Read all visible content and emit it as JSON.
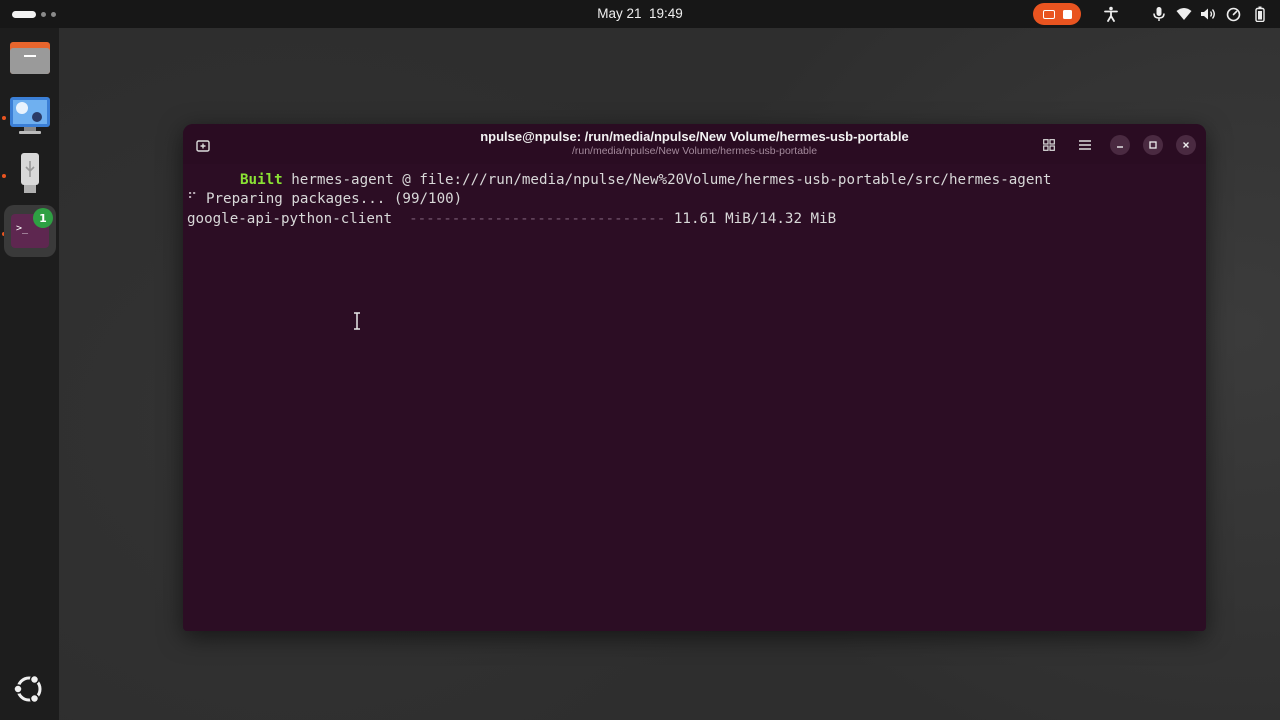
{
  "topbar": {
    "date": "May 21",
    "time": "19:49",
    "colors": {
      "recording_accent": "#e95420"
    },
    "tray_icons": [
      "accessibility-icon",
      "microphone-icon",
      "wifi-icon",
      "volume-icon",
      "power-profile-icon",
      "battery-icon"
    ]
  },
  "dock": {
    "items": [
      "files-icon",
      "remote-desktop-icon",
      "usb-drive-icon",
      "terminal-icon"
    ],
    "terminal_badge": "1",
    "show_apps": "ubuntu-logo-icon"
  },
  "terminal": {
    "title": "npulse@npulse: /run/media/npulse/New Volume/hermes-usb-portable",
    "subtitle": "/run/media/npulse/New Volume/hermes-usb-portable",
    "colors": {
      "background": "#2c0d24",
      "built": "#8ae234"
    },
    "lines": {
      "built_label": "Built",
      "built_rest": " hermes-agent @ file:///run/media/npulse/New%20Volume/hermes-usb-portable/src/hermes-agent",
      "spinner": "⠋",
      "preparing": " Preparing packages... (99/100)",
      "package_name": "google-api-python-client",
      "progress_dashes": "  ------------------------------ ",
      "progress_size": "11.61 MiB/14.32 MiB"
    },
    "download_progress_fraction": 0.81
  }
}
